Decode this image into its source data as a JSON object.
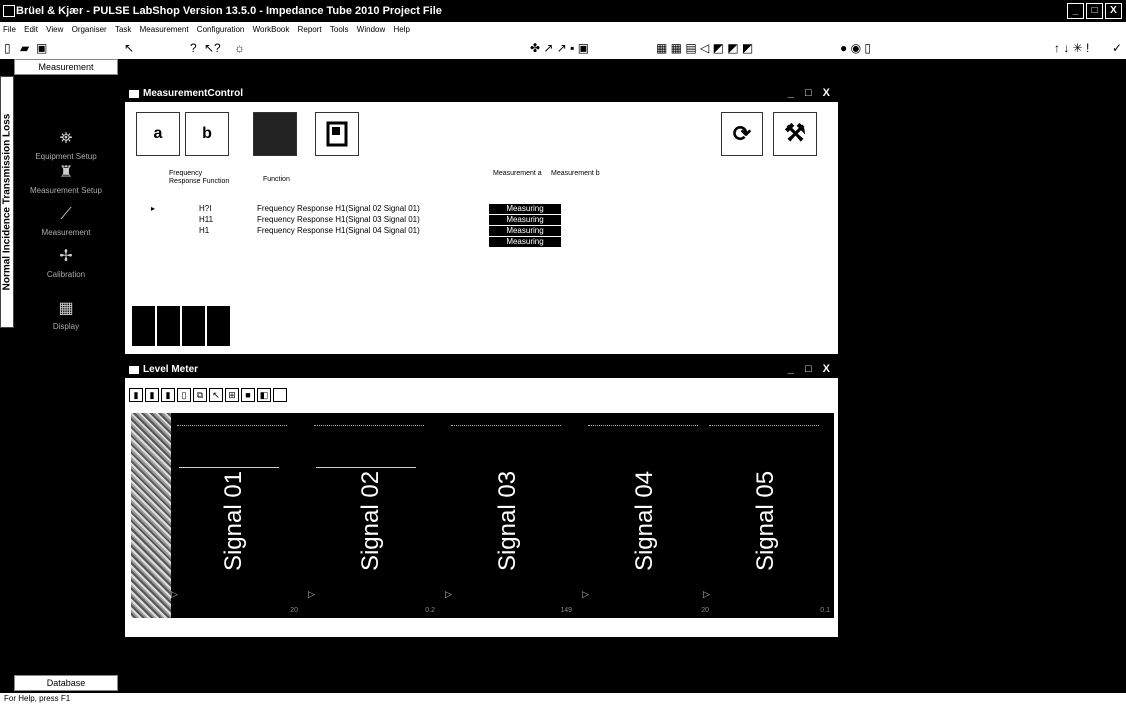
{
  "app": {
    "title": "Brüel & Kjær - PULSE LabShop Version 13.5.0 - Impedance Tube 2010 Project File",
    "window_controls": [
      "_",
      "□",
      "X"
    ]
  },
  "menu": [
    "File",
    "Edit",
    "View",
    "Organiser",
    "Task",
    "Measurement",
    "Configuration",
    "WorkBook",
    "Report",
    "Tools",
    "Window",
    "Help"
  ],
  "toolbar_icons": [
    "new-file-icon",
    "open-folder-icon",
    "save-icon",
    "pointer-icon",
    "help-icon",
    "context-help-icon",
    "bug-icon",
    "rosette-icon",
    "status-icons",
    "grid-icons",
    "record-icons",
    "arrows-up-down-icon",
    "check-icon"
  ],
  "left_panel": {
    "header": "Measurement",
    "footer": "Database",
    "vertical_tab": "Normal Incidence Transmission Loss",
    "items": [
      {
        "label": "Equipment Setup",
        "icon": "equipment-setup-icon",
        "glyph": "⛯"
      },
      {
        "label": "Measurement Setup",
        "icon": "measurement-setup-icon",
        "glyph": "♜"
      },
      {
        "label": "Measurement",
        "icon": "measurement-icon",
        "glyph": "⟋"
      },
      {
        "label": "Calibration",
        "icon": "calibration-icon",
        "glyph": "✢"
      },
      {
        "label": "Display",
        "icon": "display-icon",
        "glyph": "▦"
      }
    ]
  },
  "measurement_control": {
    "title": "MeasurementControl",
    "controls": "_ □ X",
    "buttons": {
      "a": "a",
      "b": "b"
    },
    "headers": {
      "frf": "Frequency Response Function",
      "function": "Function",
      "meas_a": "Measurement a",
      "meas_b": "Measurement b"
    },
    "rows": [
      {
        "frf": "H?I",
        "function": "Frequency Response H1(Signal 02 Signal 01)",
        "status": "Measuring"
      },
      {
        "frf": "H11",
        "function": "Frequency Response H1(Signal 03 Signal 01)",
        "status": "Measuring"
      },
      {
        "frf": "H1",
        "function": "Frequency Response H1(Signal 04 Signal 01)",
        "status": "Measuring"
      },
      {
        "frf": "",
        "function": "",
        "status": "Measuring"
      }
    ]
  },
  "level_meter": {
    "title": "Level Meter",
    "controls": "_ □ X",
    "meters": [
      {
        "label": "Signal 01",
        "value": "20"
      },
      {
        "label": "Signal 02",
        "value": "0.2"
      },
      {
        "label": "Signal 03",
        "value": "149"
      },
      {
        "label": "Signal 04",
        "value": "20"
      },
      {
        "label": "Signal 05",
        "value": "0.1"
      }
    ]
  },
  "status": "For Help, press F1"
}
